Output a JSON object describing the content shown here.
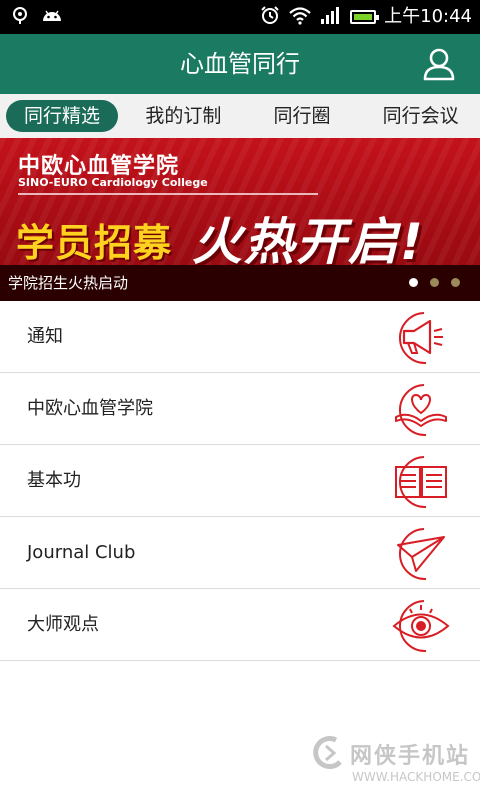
{
  "status_bar": {
    "time": "上午10:44",
    "icons": [
      "notification-icon",
      "android-icon",
      "alarm-icon",
      "wifi-icon",
      "signal-icon",
      "battery-icon"
    ]
  },
  "app_bar": {
    "title": "心血管同行",
    "user_icon": "user-icon"
  },
  "tabs": [
    {
      "label": "同行精选",
      "active": true
    },
    {
      "label": "我的订制",
      "active": false
    },
    {
      "label": "同行圈",
      "active": false
    },
    {
      "label": "同行会议",
      "active": false
    }
  ],
  "banner": {
    "title": "中欧心血管学院",
    "subtitle": "SINO-EURO Cardiology College",
    "headline_left": "学员招募",
    "headline_right": "火热开启!",
    "caption": "学院招生火热启动",
    "page_count": 3,
    "current_page": 1
  },
  "menu": [
    {
      "label": "通知",
      "icon": "megaphone-icon"
    },
    {
      "label": "中欧心血管学院",
      "icon": "heart-book-icon"
    },
    {
      "label": "基本功",
      "icon": "open-book-icon"
    },
    {
      "label": "Journal Club",
      "icon": "paper-plane-icon"
    },
    {
      "label": "大师观点",
      "icon": "eye-icon"
    }
  ],
  "watermark": {
    "brand": "网侠手机站",
    "url": "WWW.HACKHOME.COM"
  },
  "colors": {
    "primary": "#1a7a62",
    "accent_red": "#d81e24",
    "banner_red": "#c4121b"
  }
}
